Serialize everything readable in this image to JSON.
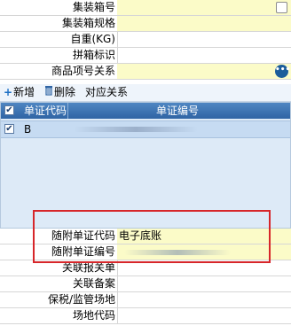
{
  "form_top": {
    "rows": [
      {
        "label": "集装箱号",
        "value": "",
        "has_checkbox": true
      },
      {
        "label": "集装箱规格",
        "value": ""
      },
      {
        "label": "自重(KG)",
        "value": ""
      },
      {
        "label": "拼箱标识",
        "value": ""
      },
      {
        "label": "商品项号关系",
        "value": "",
        "has_menu_button": true
      }
    ],
    "menu_button_glyph": "•••"
  },
  "toolbar": {
    "add_label": "新增",
    "add_icon": "+",
    "delete_label": "删除",
    "delete_icon": "trash-icon",
    "relation_label": "对应关系"
  },
  "doc_grid": {
    "columns": [
      "单证代码",
      "单证编号"
    ],
    "rows": [
      {
        "code": "B",
        "number": "",
        "checked": true
      }
    ],
    "header_checked": true
  },
  "form_bottom": {
    "rows": [
      {
        "label": "随附单证代码",
        "value": "电子底账"
      },
      {
        "label": "随附单证编号",
        "value": ""
      },
      {
        "label": "关联报关单",
        "value": ""
      },
      {
        "label": "关联备案",
        "value": ""
      },
      {
        "label": "保税/监管场地",
        "value": ""
      },
      {
        "label": "场地代码",
        "value": ""
      }
    ]
  },
  "colors": {
    "field_yellow": "#fbfbc8",
    "grid_header": "#3a70b0",
    "highlight_box": "#d7262a"
  }
}
